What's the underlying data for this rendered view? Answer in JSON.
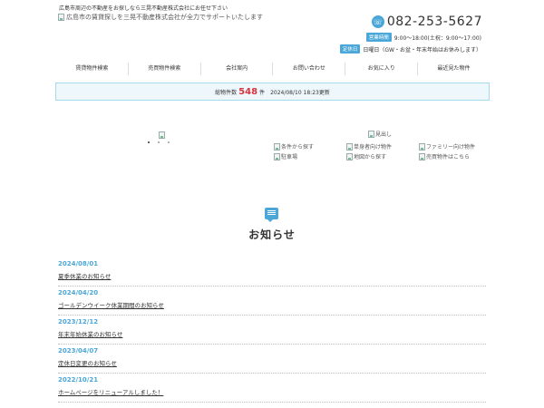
{
  "header": {
    "tagline": "広島市周辺の不動産をお探しなら三晃不動産株式会社にお任せ下さい",
    "logo_alt": "広島市の賃貸探しを三晃不動産株式会社が全力でサポートいたします",
    "phone": "082-253-5627",
    "hours_badge": "営業時間",
    "hours_text": "9:00～18:00(土祝：9:00～17:00)",
    "holiday_badge": "定休日",
    "holiday_text": "日曜日（GW・お盆・年末年始はお休みします）"
  },
  "nav": {
    "items": [
      "賃貸物件検索",
      "売買物件検索",
      "会社案内",
      "お問い合わせ",
      "お気に入り",
      "最近見た物件"
    ]
  },
  "counter": {
    "label": "総物件数",
    "count": "548",
    "unit": "件",
    "updated": "2024/08/10 18:23更新"
  },
  "features": {
    "heading_alt": "見出し",
    "links": [
      "条件から探す",
      "単身者向け物件",
      "ファミリー向け物件",
      "駐車場",
      "地図から探す",
      "売買物件はこちら"
    ]
  },
  "news": {
    "title": "お知らせ",
    "items": [
      {
        "date": "2024/08/01",
        "title": "夏季休業のお知らせ"
      },
      {
        "date": "2024/04/20",
        "title": "ゴールデンウイーク休業期間のお知らせ"
      },
      {
        "date": "2023/12/12",
        "title": "年末年始休業のお知らせ"
      },
      {
        "date": "2023/04/07",
        "title": "定休日変更のお知らせ"
      },
      {
        "date": "2022/10/21",
        "title": "ホームページをリニューアルしました！"
      }
    ]
  },
  "colors": {
    "accent": "#4aa7d8",
    "count_red": "#d9333f",
    "counter_bg": "#eef8fc"
  }
}
